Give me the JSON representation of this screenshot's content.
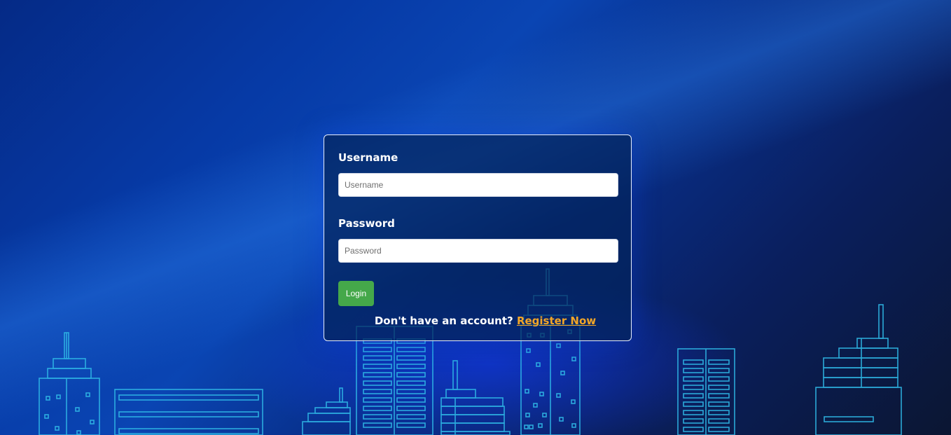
{
  "form": {
    "username_label": "Username",
    "username_placeholder": "Username",
    "username_value": "",
    "password_label": "Password",
    "password_placeholder": "Password",
    "password_value": "",
    "login_label": "Login",
    "register_prompt": "Don't have an account?",
    "register_link": "Register Now"
  },
  "colors": {
    "card_border": "#e8eefc",
    "login_button": "#45a84a",
    "register_link": "#f2a628",
    "building_outline": "#2fb8e6"
  }
}
